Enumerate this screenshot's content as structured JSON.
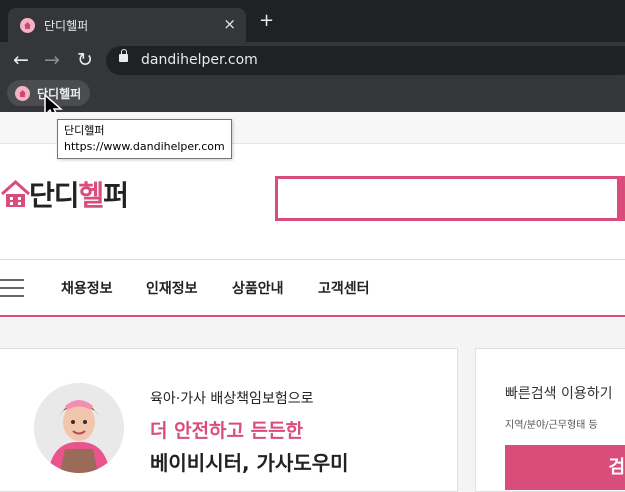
{
  "browser": {
    "tab": {
      "title": "단디헬퍼",
      "close_glyph": "×"
    },
    "new_tab_glyph": "+",
    "nav": {
      "back_glyph": "←",
      "forward_glyph": "→",
      "reload_glyph": "↻"
    },
    "address": {
      "url": "dandihelper.com"
    },
    "bookmark": {
      "label": "단디헬퍼"
    },
    "tooltip": {
      "title": "단디헬퍼",
      "url": "https://www.dandihelper.com"
    }
  },
  "site": {
    "logo": {
      "part1": "단디",
      "part2": "헬",
      "part3": "퍼"
    },
    "menu": [
      "채용정보",
      "인재정보",
      "상품안내",
      "고객센터"
    ],
    "hero": {
      "line1": "육아·가사 배상책임보험으로",
      "line2": "더 안전하고 든든한",
      "line3": "베이비시터, 가사도우미"
    },
    "quick": {
      "title": "빠른검색 이용하기",
      "subtitle": "지역/분야/근무형태 등",
      "button_label": "검"
    }
  },
  "colors": {
    "accent": "#d94d7b",
    "browser_dark": "#202124",
    "browser_panel": "#35363a"
  },
  "icons": [
    "home-favicon-icon",
    "lock-icon",
    "menu-icon",
    "mouse-cursor-icon"
  ]
}
